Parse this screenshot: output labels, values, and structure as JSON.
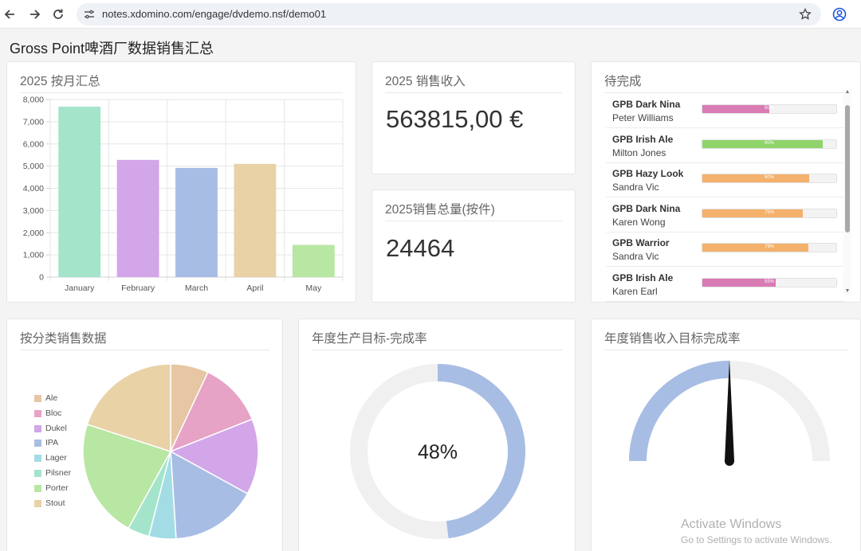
{
  "browser": {
    "url": "notes.xdomino.com/engage/dvdemo.nsf/demo01",
    "back_icon": "arrow-left-icon",
    "forward_icon": "arrow-right-icon",
    "reload_icon": "reload-icon",
    "site_info_icon": "tune-icon",
    "bookmark_icon": "star-icon",
    "profile_icon": "account-icon"
  },
  "header": {
    "title": "Gross Point啤酒厂数据销售汇总"
  },
  "cards": {
    "monthly": {
      "title": "2025 按月汇总"
    },
    "revenue": {
      "title": "2025 销售收入",
      "value": "563815,00 €"
    },
    "volume": {
      "title": "2025销售总量(按件)",
      "value": "24464"
    },
    "tasks": {
      "title": "待完成"
    },
    "category": {
      "title": "按分类销售数据"
    },
    "production": {
      "title": "年度生产目标-完成率"
    },
    "revenue_target": {
      "title": "年度销售收入目标完成率"
    }
  },
  "tasks": [
    {
      "name": "GPB Dark Nina",
      "person": "Peter Williams",
      "percent": 50,
      "label": "50%",
      "color": "#d97bb4"
    },
    {
      "name": "GPB Irish Ale",
      "person": "Milton Jones",
      "percent": 90,
      "label": "90%",
      "color": "#8fd46b"
    },
    {
      "name": "GPB Hazy Look",
      "person": "Sandra Vic",
      "percent": 80,
      "label": "80%",
      "color": "#f3b16c"
    },
    {
      "name": "GPB Dark Nina",
      "person": "Karen Wong",
      "percent": 75,
      "label": "75%",
      "color": "#f3b16c"
    },
    {
      "name": "GPB Warrior",
      "person": "Sandra Vic",
      "percent": 79,
      "label": "79%",
      "color": "#f3b16c"
    },
    {
      "name": "GPB Irish Ale",
      "person": "Karen Earl",
      "percent": 55,
      "label": "55%",
      "color": "#d97bb4"
    }
  ],
  "watermark": {
    "title": "Activate Windows",
    "subtitle": "Go to Settings to activate Windows."
  },
  "chart_data": [
    {
      "type": "bar",
      "categories": [
        "January",
        "February",
        "March",
        "April",
        "May"
      ],
      "values": [
        7680,
        5280,
        4920,
        5100,
        1450
      ],
      "colors": [
        "#a3e4cb",
        "#d2a6e8",
        "#a8bde4",
        "#e8d2a6",
        "#b8e6a3"
      ],
      "ylim": [
        0,
        8000
      ],
      "yticks": [
        0,
        1000,
        2000,
        3000,
        4000,
        5000,
        6000,
        7000,
        8000
      ],
      "ytick_labels": [
        "0",
        "1,000",
        "2,000",
        "3,000",
        "4,000",
        "5,000",
        "6,000",
        "7,000",
        "8,000"
      ],
      "grid": true
    },
    {
      "type": "pie",
      "labels": [
        "Ale",
        "Bloc",
        "Dukel",
        "IPA",
        "Lager",
        "Pilsner",
        "Porter",
        "Stout"
      ],
      "values": [
        7,
        12,
        14,
        16,
        5,
        4,
        22,
        20
      ],
      "colors": [
        "#e6c6a3",
        "#e6a3c6",
        "#d2a6e8",
        "#a8bde4",
        "#a3dce4",
        "#a3e4cb",
        "#b8e6a3",
        "#e8d2a6"
      ],
      "legend": "left"
    },
    {
      "type": "doughnut",
      "value": 48,
      "label": "48%",
      "colors": [
        "#a8bde4",
        "#f0f0f0"
      ]
    },
    {
      "type": "gauge",
      "value": 50,
      "range": [
        0,
        100
      ],
      "colors": [
        "#a8bde4",
        "#f0f0f0",
        "#111111"
      ]
    }
  ]
}
